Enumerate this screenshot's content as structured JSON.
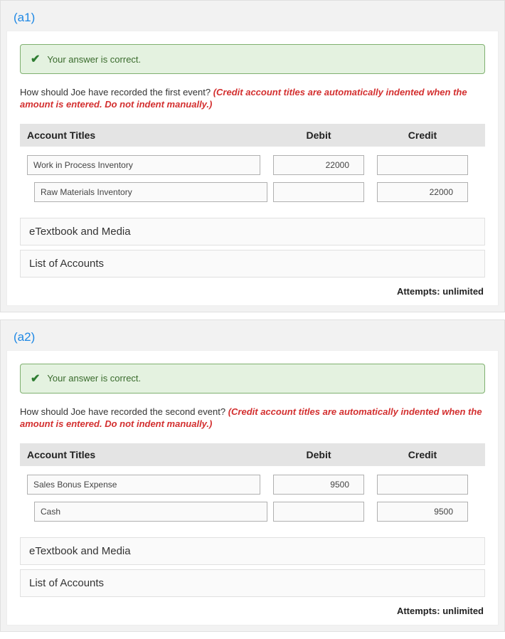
{
  "parts": [
    {
      "id": "(a1)",
      "status": "Your answer is correct.",
      "prompt_plain": "How should Joe have recorded the first event? ",
      "prompt_hint": "(Credit account titles are automatically indented when the amount is entered. Do not indent manually.)",
      "headers": {
        "title": "Account Titles",
        "debit": "Debit",
        "credit": "Credit"
      },
      "rows": [
        {
          "title": "Work in Process Inventory",
          "debit": "22000",
          "credit": ""
        },
        {
          "title": "Raw Materials Inventory",
          "debit": "",
          "credit": "22000"
        }
      ],
      "links": {
        "etext": "eTextbook and Media",
        "accounts": "List of Accounts"
      },
      "attempts": "Attempts: unlimited"
    },
    {
      "id": "(a2)",
      "status": "Your answer is correct.",
      "prompt_plain": "How should Joe have recorded the second event? ",
      "prompt_hint": "(Credit account titles are automatically indented when the amount is entered. Do not indent manually.)",
      "headers": {
        "title": "Account Titles",
        "debit": "Debit",
        "credit": "Credit"
      },
      "rows": [
        {
          "title": "Sales Bonus Expense",
          "debit": "9500",
          "credit": ""
        },
        {
          "title": "Cash",
          "debit": "",
          "credit": "9500"
        }
      ],
      "links": {
        "etext": "eTextbook and Media",
        "accounts": "List of Accounts"
      },
      "attempts": "Attempts: unlimited"
    }
  ]
}
